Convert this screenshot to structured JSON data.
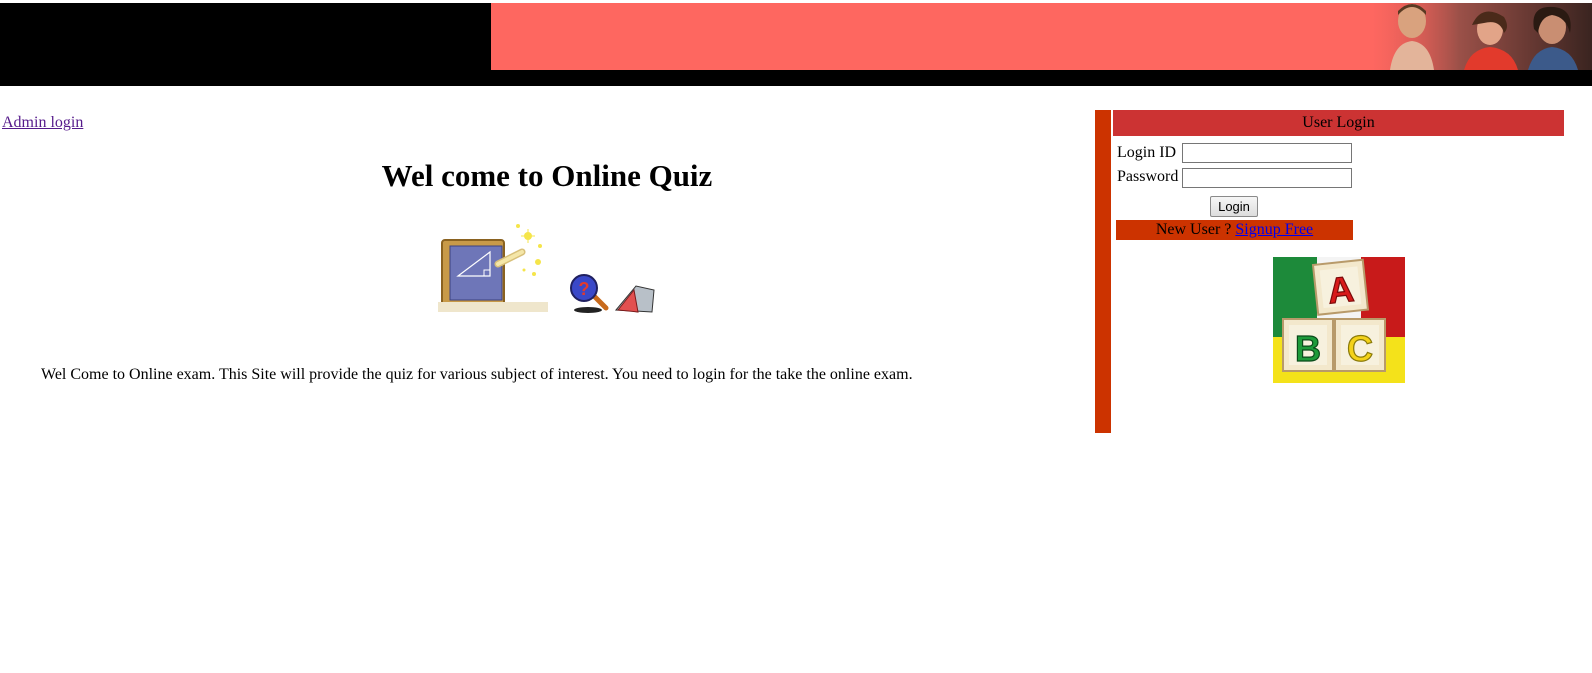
{
  "header": {
    "banner_color": "#fe6760",
    "banner_background": "#000000"
  },
  "nav": {
    "admin_login_label": "Admin login"
  },
  "main": {
    "title": "Wel come to Online Quiz",
    "intro_text": "Wel Come to Online exam. This Site will provide the quiz for various subject of interest. You need to login for the take the online exam."
  },
  "login_panel": {
    "header": "User Login",
    "login_id_label": "Login ID",
    "login_id_value": "",
    "password_label": "Password",
    "password_value": "",
    "login_button_label": "Login",
    "new_user_text": "New User ?",
    "signup_link_label": "Signup Free",
    "header_color": "#cc3333",
    "accent_color": "#cc3300"
  },
  "icons": {
    "banner": "people-photo-icon",
    "illustration": "chalkboard-triangle-icon",
    "search": "magnifier-question-icon",
    "book": "open-book-icon",
    "blocks": "abc-blocks-icon"
  }
}
